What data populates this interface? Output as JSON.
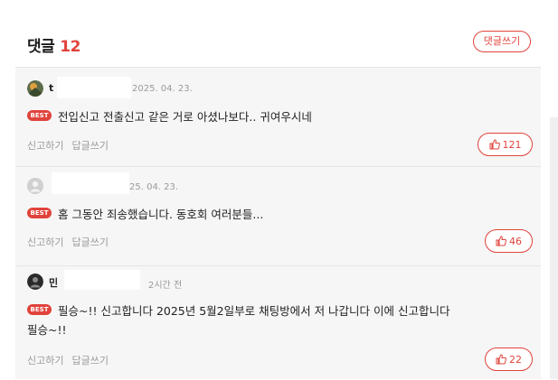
{
  "header": {
    "title": "댓글",
    "count": "12",
    "write_button": "댓글쓰기"
  },
  "best_badge": "BEST",
  "actions": {
    "report": "신고하기",
    "reply": "답글쓰기"
  },
  "comments": [
    {
      "name": "t",
      "date": "2025. 04. 23.",
      "text": "전입신고 전출신고 같은 거로 아셨나보다.. 귀여우시네",
      "likes": "121",
      "avatar_icon": "photo-avatar-icon"
    },
    {
      "name": "",
      "date": "25. 04. 23.",
      "text": "홈 그동안 죄송했습니다. 동호회 여러분들...",
      "likes": "46",
      "avatar_icon": "default-user-icon"
    },
    {
      "name": "민",
      "date": "2시간 전",
      "text_line1": "필승~!! 신고합니다 2025년 5월2일부로 채팅방에서 저 나갑니다 이에 신고합니다",
      "text_line2": "필승~!!",
      "likes": "22",
      "avatar_icon": "dark-avatar-icon"
    }
  ],
  "colors": {
    "accent": "#e0433b",
    "muted": "#9a9a9a",
    "list_bg": "#f6f6f6"
  }
}
